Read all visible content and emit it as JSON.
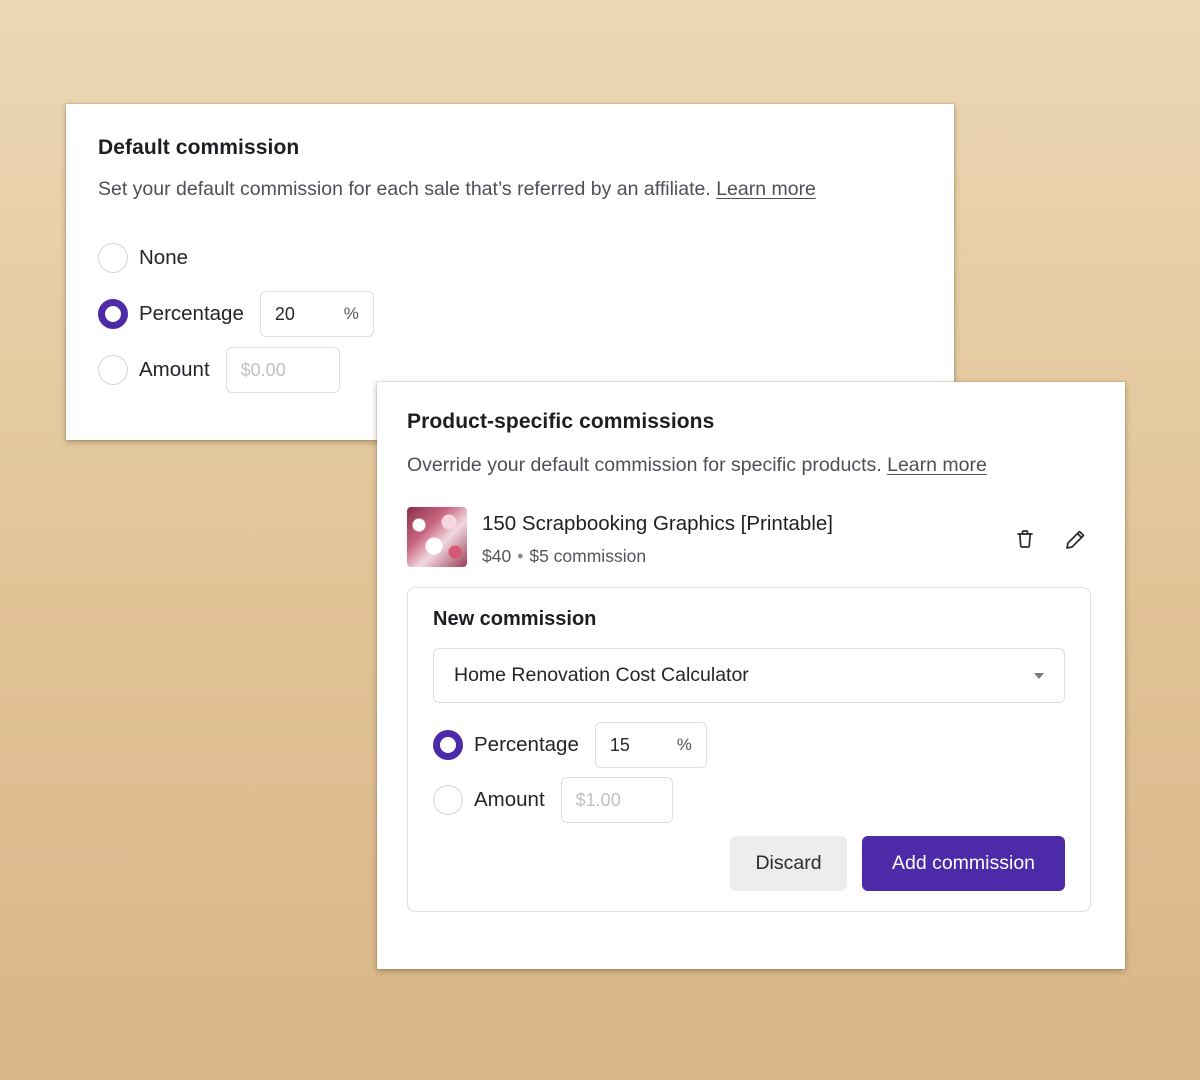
{
  "default_commission": {
    "title": "Default commission",
    "description": "Set your default commission for each sale that’s referred by an affiliate.",
    "learn_more": "Learn more",
    "options": {
      "none": {
        "label": "None",
        "checked": false
      },
      "percentage": {
        "label": "Percentage",
        "value": "20",
        "suffix": "%",
        "checked": true
      },
      "amount": {
        "label": "Amount",
        "placeholder": "$0.00",
        "checked": false
      }
    }
  },
  "product_commissions": {
    "title": "Product-specific commissions",
    "description": "Override your default commission for specific products.",
    "learn_more": "Learn more",
    "items": [
      {
        "name": "150 Scrapbooking Graphics [Printable]",
        "price": "$40",
        "separator": "•",
        "commission": "$5 commission",
        "delete_icon": "trash-icon",
        "edit_icon": "pencil-icon"
      }
    ],
    "new_commission": {
      "title": "New commission",
      "selected_product": "Home Renovation Cost Calculator",
      "percentage": {
        "label": "Percentage",
        "value": "15",
        "suffix": "%",
        "checked": true
      },
      "amount": {
        "label": "Amount",
        "placeholder": "$1.00",
        "checked": false
      },
      "discard_label": "Discard",
      "add_label": "Add commission"
    }
  },
  "colors": {
    "accent": "#4d2aa8",
    "background_top": "#ecd8b6",
    "background_bottom": "#d8b68a"
  }
}
